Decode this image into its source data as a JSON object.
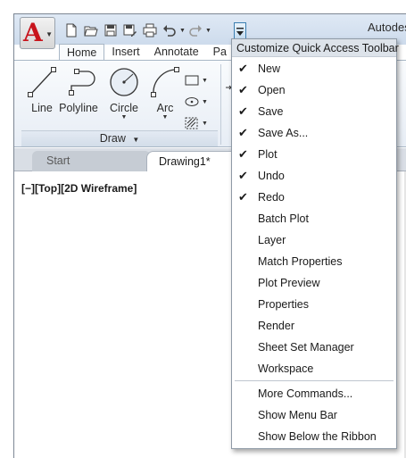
{
  "window": {
    "title": "Autodes"
  },
  "qat": {
    "icons": [
      "new-icon",
      "open-icon",
      "save-icon",
      "save-as-icon",
      "plot-icon",
      "undo-icon",
      "redo-icon"
    ],
    "customize_icon": "chevron-down-icon"
  },
  "ribbon": {
    "tabs": [
      "Home",
      "Insert",
      "Annotate",
      "Pa"
    ],
    "active_tab": "Home",
    "tools": [
      "Line",
      "Polyline",
      "Circle",
      "Arc"
    ],
    "panel_title": "Draw"
  },
  "file_tabs": [
    "Start",
    "Drawing1*"
  ],
  "viewport_label": "[−][Top][2D Wireframe]",
  "menu": {
    "header": "Customize Quick Access Toolbar",
    "items": [
      {
        "label": "New",
        "checked": true
      },
      {
        "label": "Open",
        "checked": true
      },
      {
        "label": "Save",
        "checked": true
      },
      {
        "label": "Save As...",
        "checked": true
      },
      {
        "label": "Plot",
        "checked": true
      },
      {
        "label": "Undo",
        "checked": true
      },
      {
        "label": "Redo",
        "checked": true
      },
      {
        "label": "Batch Plot",
        "checked": false
      },
      {
        "label": "Layer",
        "checked": false
      },
      {
        "label": "Match Properties",
        "checked": false
      },
      {
        "label": "Plot Preview",
        "checked": false
      },
      {
        "label": "Properties",
        "checked": false
      },
      {
        "label": "Render",
        "checked": false
      },
      {
        "label": "Sheet Set Manager",
        "checked": false
      },
      {
        "label": "Workspace",
        "checked": false
      }
    ],
    "more_items": [
      "More Commands...",
      "Show Menu Bar",
      "Show Below the Ribbon"
    ]
  },
  "colors": {
    "logo_red": "#c8141c",
    "title_bar": "#dfe9f5",
    "menu_header": "#dde3ea"
  }
}
